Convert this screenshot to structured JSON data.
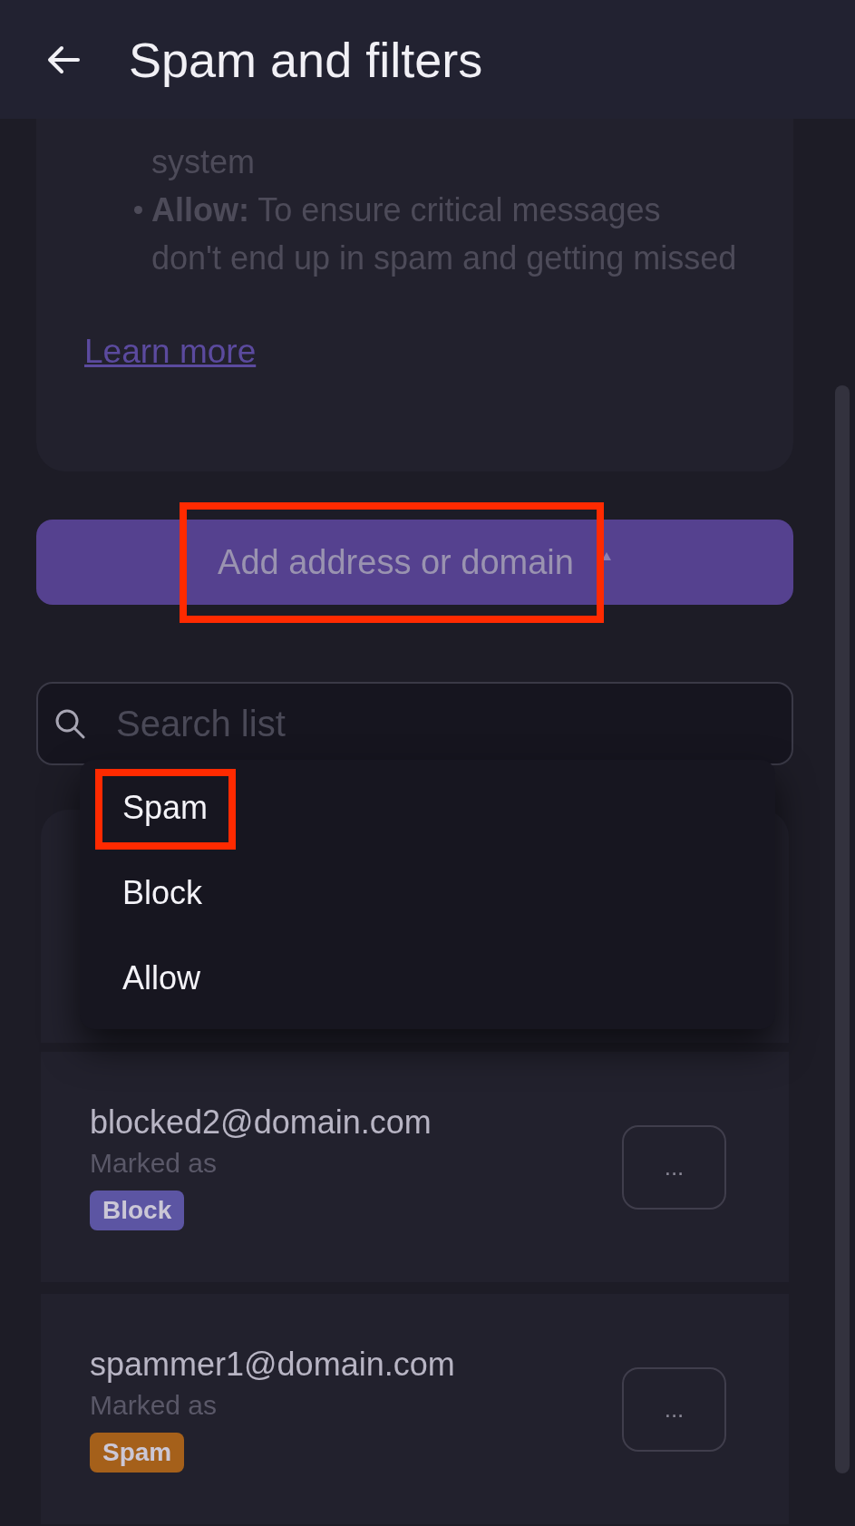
{
  "header": {
    "title": "Spam and filters"
  },
  "info_card": {
    "bullets": [
      {
        "kind": "continuation",
        "text": "system"
      },
      {
        "kind": "bullet",
        "text": "**Allow:** To ensure critical messages don't end up in spam and getting missed"
      }
    ],
    "link": "Learn more"
  },
  "add_button": {
    "label": "Add address or domain",
    "highlighted": true
  },
  "search": {
    "placeholder": "Search list"
  },
  "menu": {
    "items": [
      {
        "label": "Spam",
        "highlighted": true
      },
      {
        "label": "Block",
        "highlighted": false
      },
      {
        "label": "Allow",
        "highlighted": false
      }
    ]
  },
  "entries": [
    {
      "email": "blocked2@domain.com",
      "caption": "Marked as",
      "tag": "Block",
      "color": "#5c55a3",
      "more": "..."
    },
    {
      "email": "spammer1@domain.com",
      "caption": "Marked as",
      "tag": "Spam",
      "color": "#a5601a",
      "more": "..."
    }
  ]
}
